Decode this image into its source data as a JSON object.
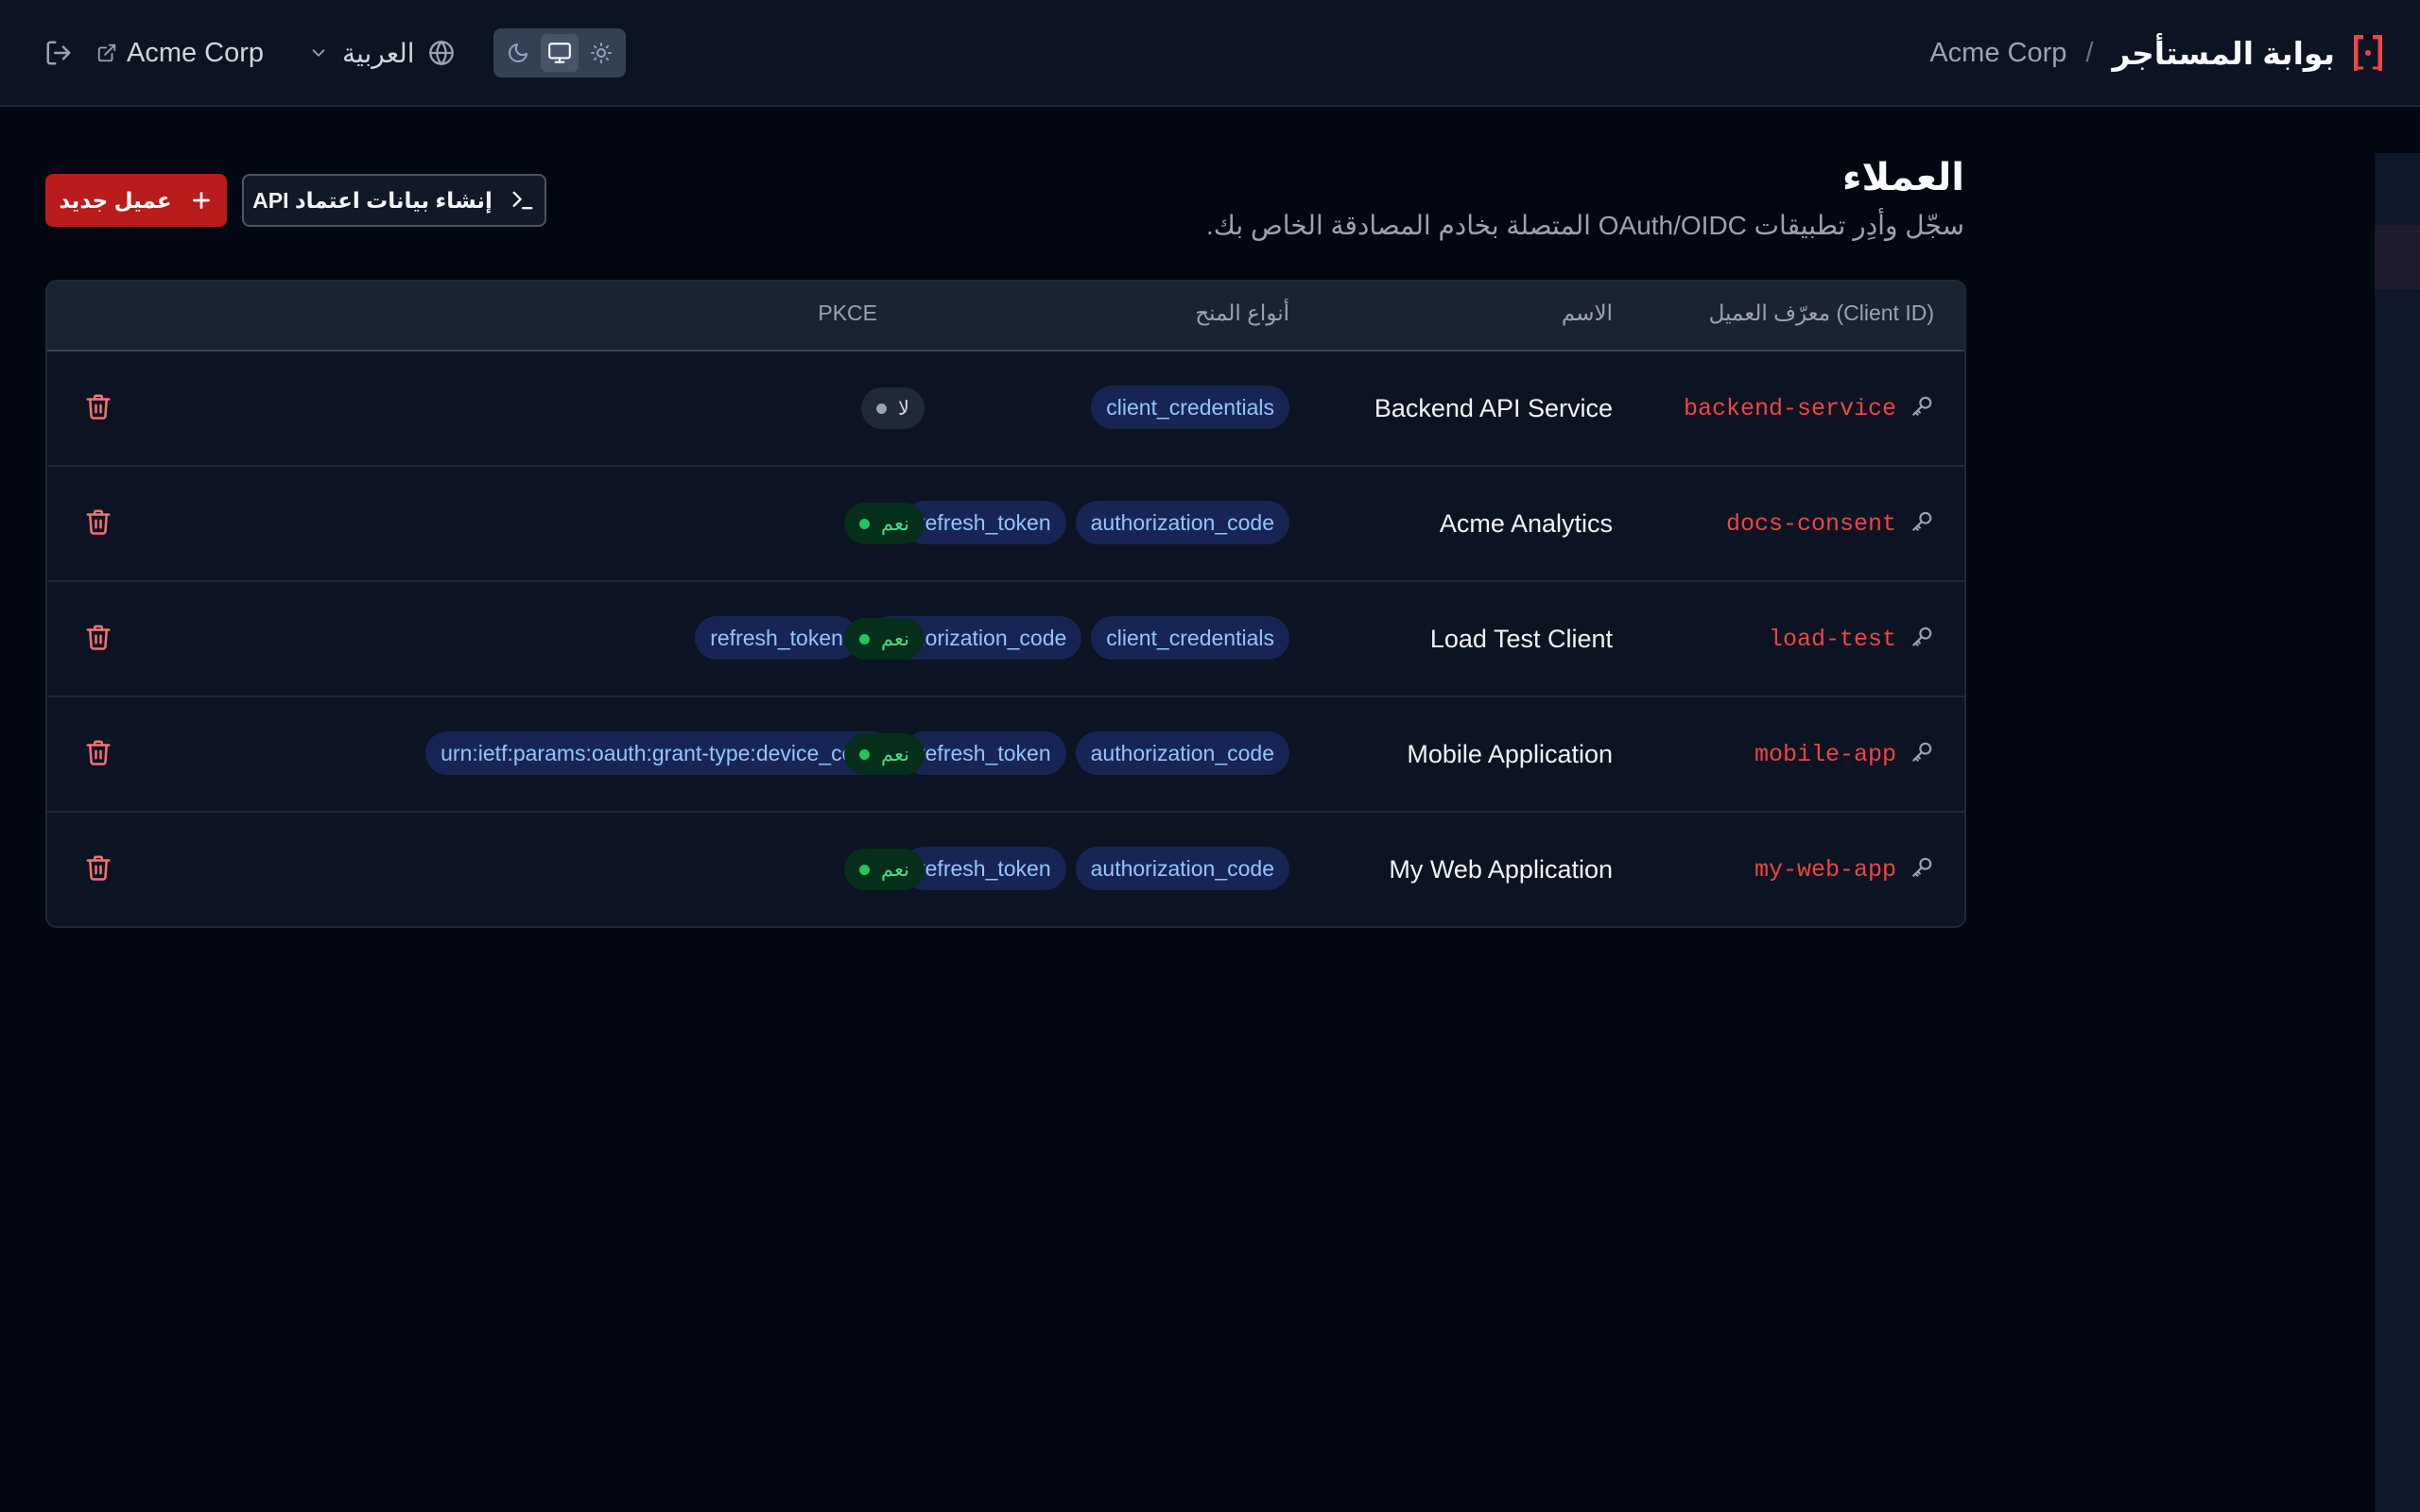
{
  "header": {
    "title": "بوابة المستأجر",
    "separator": "/",
    "tenant": "Acme Corp",
    "tenant_link": "Acme Corp",
    "language": "العربية",
    "theme_options": [
      "dark",
      "system",
      "light"
    ],
    "theme_active": "system"
  },
  "page": {
    "title": "العملاء",
    "subtitle": "سجّل وأدِر تطبيقات OAuth/OIDC المتصلة بخادم المصادقة الخاص بك."
  },
  "actions": {
    "new_client": "عميل جديد",
    "create_api": "إنشاء بيانات اعتماد API"
  },
  "table": {
    "headers": {
      "client_id": "معرّف العميل (Client ID)",
      "name": "الاسم",
      "grants": "أنواع المنح",
      "pkce": "PKCE"
    },
    "rows": [
      {
        "client_id": "backend-service",
        "name": "Backend API Service",
        "grants": [
          "client_credentials"
        ],
        "pkce": "لا",
        "pkce_enabled": false
      },
      {
        "client_id": "docs-consent",
        "name": "Acme Analytics",
        "grants": [
          "authorization_code",
          "refresh_token"
        ],
        "pkce": "نعم",
        "pkce_enabled": true
      },
      {
        "client_id": "load-test",
        "name": "Load Test Client",
        "grants": [
          "client_credentials",
          "authorization_code",
          "refresh_token"
        ],
        "pkce": "نعم",
        "pkce_enabled": true
      },
      {
        "client_id": "mobile-app",
        "name": "Mobile Application",
        "grants": [
          "authorization_code",
          "refresh_token",
          "urn:ietf:params:oauth:grant-type:device_code"
        ],
        "pkce": "نعم",
        "pkce_enabled": true
      },
      {
        "client_id": "my-web-app",
        "name": "My Web Application",
        "grants": [
          "authorization_code",
          "refresh_token"
        ],
        "pkce": "نعم",
        "pkce_enabled": true
      }
    ]
  },
  "colors": {
    "accent": "#ef4444",
    "primary_button": "#b91c1c",
    "tag_bg": "#172554",
    "tag_text": "#93c5fd",
    "pkce_yes": "#22c55e"
  }
}
